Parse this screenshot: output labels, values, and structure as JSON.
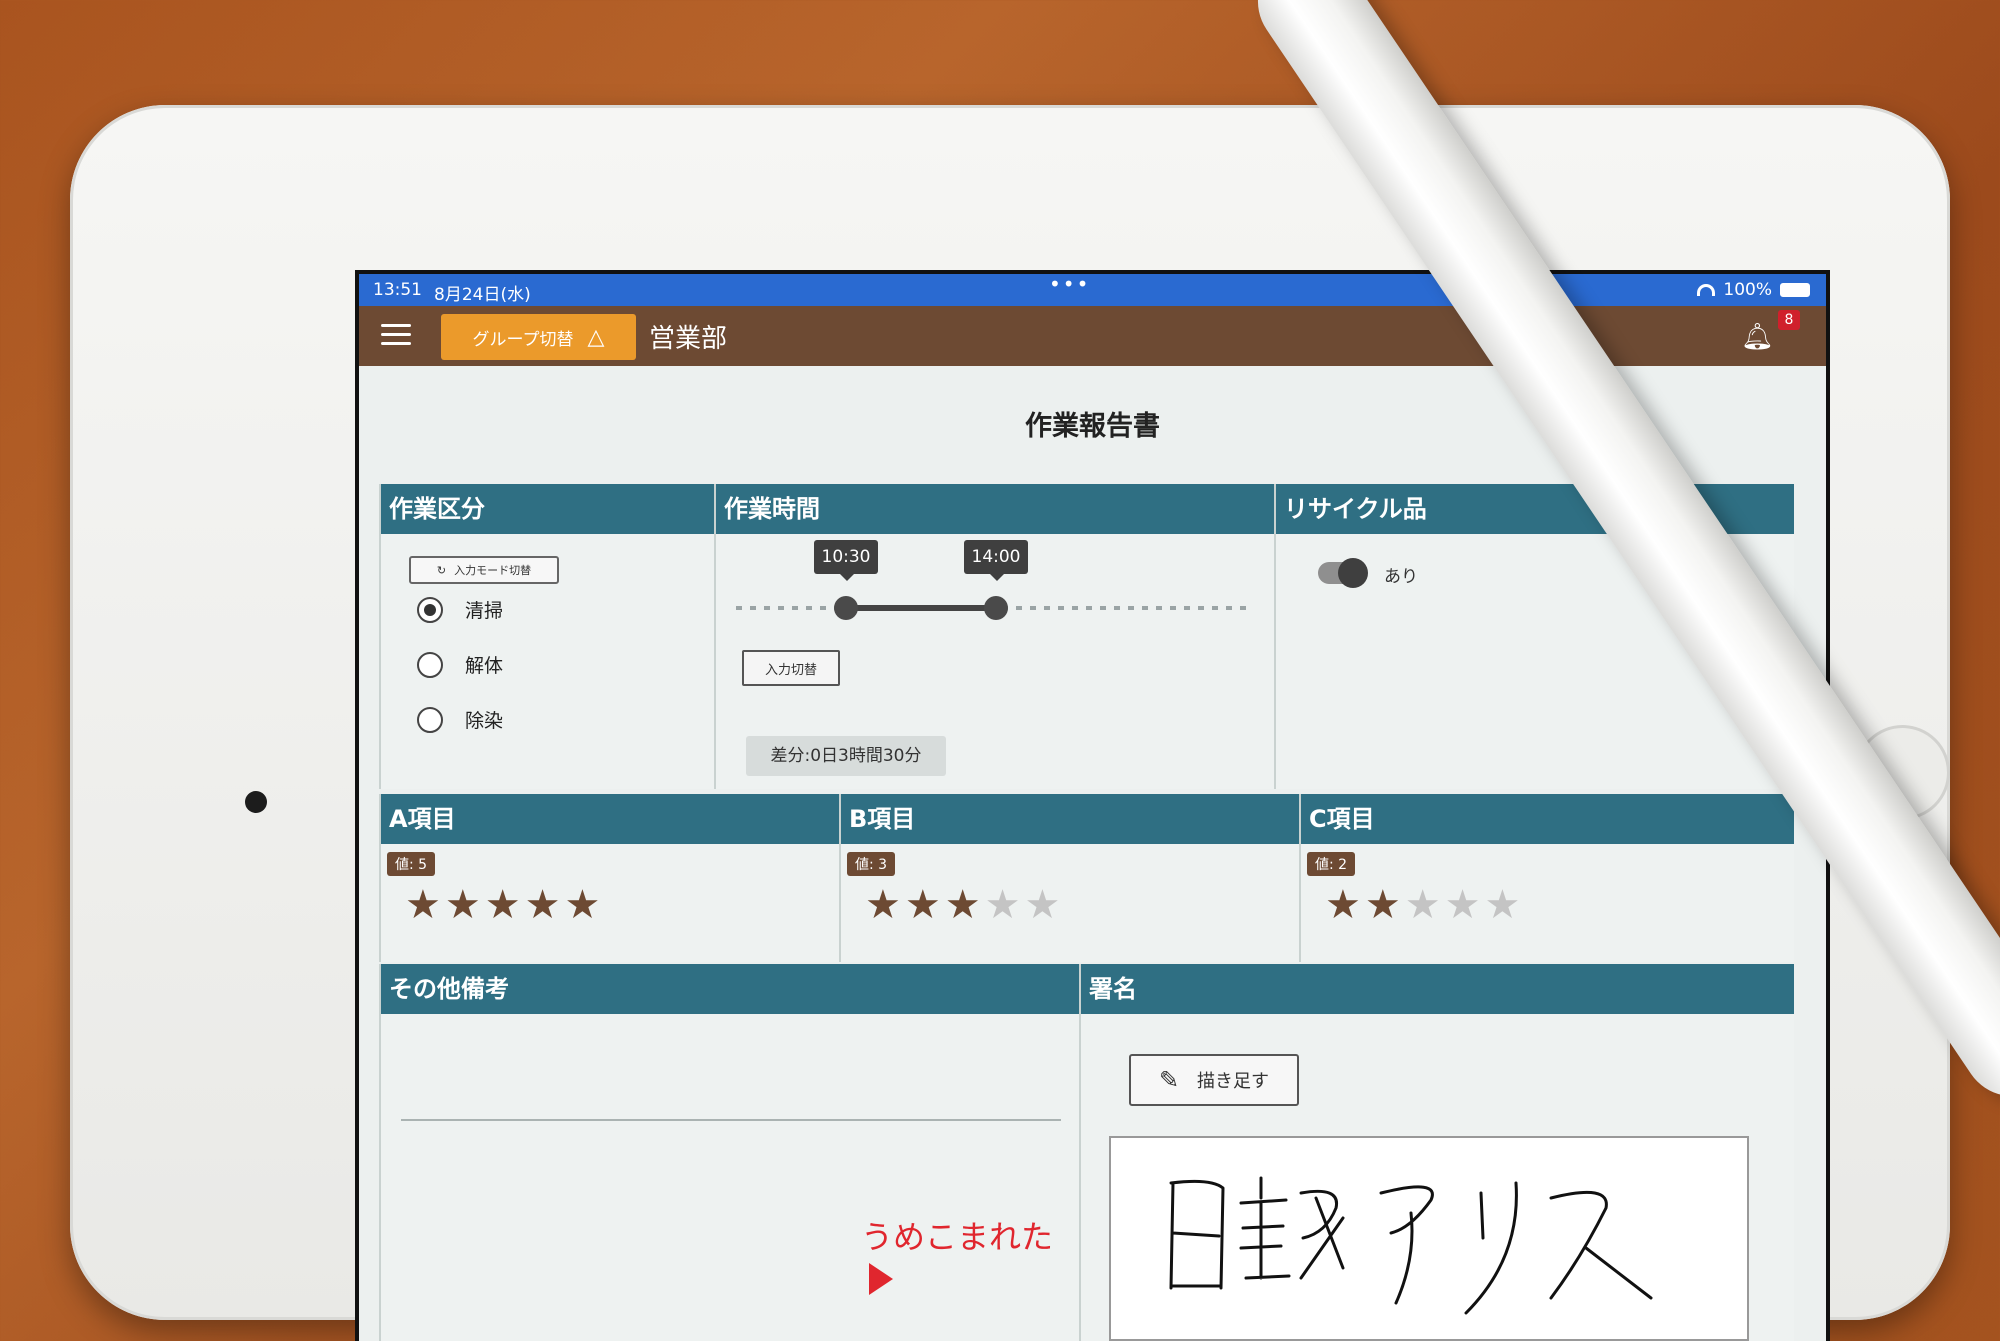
{
  "status_bar": {
    "time": "13:51",
    "date": "8月24日(水)",
    "dots": "•••",
    "battery": "100%"
  },
  "app_bar": {
    "group_button_label": "グループ切替",
    "department": "営業部",
    "notification_count": "8"
  },
  "form": {
    "title": "作業報告書",
    "work_type": {
      "header": "作業区分",
      "mode_button": "入力モード切替",
      "options": [
        "清掃",
        "解体",
        "除染"
      ],
      "selected": "清掃"
    },
    "work_time": {
      "header": "作業時間",
      "start": "10:30",
      "end": "14:00",
      "input_toggle": "入力切替",
      "difference": "差分:0日3時間30分"
    },
    "recycle": {
      "header": "リサイクル品",
      "toggle_label": "あり",
      "toggle_on": true
    },
    "ratings": [
      {
        "header": "A項目",
        "badge": "値: 5",
        "value": 5,
        "max": 5
      },
      {
        "header": "B項目",
        "badge": "値: 3",
        "value": 3,
        "max": 5
      },
      {
        "header": "C項目",
        "badge": "値: 2",
        "value": 2,
        "max": 5
      }
    ],
    "remarks": {
      "header": "その他備考"
    },
    "signature": {
      "header": "署名",
      "draw_button": "描き足す",
      "signed_text": "日報アリス"
    }
  },
  "annotation": "うめこまれた",
  "colors": {
    "header_teal": "#2f6f83",
    "app_bar_brown": "#6d4a33",
    "group_button_orange": "#eb9a2b",
    "status_blue": "#2a6ad1",
    "annotation_red": "#e0262e"
  }
}
